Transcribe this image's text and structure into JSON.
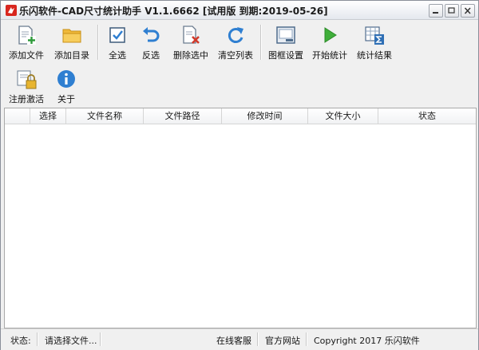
{
  "window": {
    "title": "乐闪软件-CAD尺寸统计助手 V1.1.6662 [试用版 到期:2019-05-26]"
  },
  "toolbar": {
    "row1": [
      {
        "id": "add-file",
        "label": "添加文件",
        "icon": "add-file-icon"
      },
      {
        "id": "add-folder",
        "label": "添加目录",
        "icon": "folder-icon"
      },
      {
        "id": "select-all",
        "label": "全选",
        "icon": "checkbox-icon"
      },
      {
        "id": "invert",
        "label": "反选",
        "icon": "undo-arrow-icon"
      },
      {
        "id": "delete-selected",
        "label": "删除选中",
        "icon": "delete-doc-icon"
      },
      {
        "id": "clear-list",
        "label": "清空列表",
        "icon": "refresh-icon"
      },
      {
        "id": "frame-settings",
        "label": "图框设置",
        "icon": "frame-icon"
      },
      {
        "id": "start",
        "label": "开始统计",
        "icon": "play-icon"
      },
      {
        "id": "results",
        "label": "统计结果",
        "icon": "sum-table-icon"
      }
    ],
    "row2": [
      {
        "id": "register",
        "label": "注册激活",
        "icon": "lock-icon"
      },
      {
        "id": "about",
        "label": "关于",
        "icon": "info-icon"
      }
    ]
  },
  "table": {
    "columns": [
      "选择",
      "文件名称",
      "文件路径",
      "修改时间",
      "文件大小",
      "状态"
    ]
  },
  "status": {
    "label": "状态:",
    "message": "请选择文件...",
    "online_service": "在线客服",
    "official_site": "官方网站",
    "copyright": "Copyright 2017 乐闪软件"
  },
  "colors": {
    "accent": "#2f7fd1",
    "play_green": "#3fae3a",
    "delete_red": "#d23a2a"
  }
}
